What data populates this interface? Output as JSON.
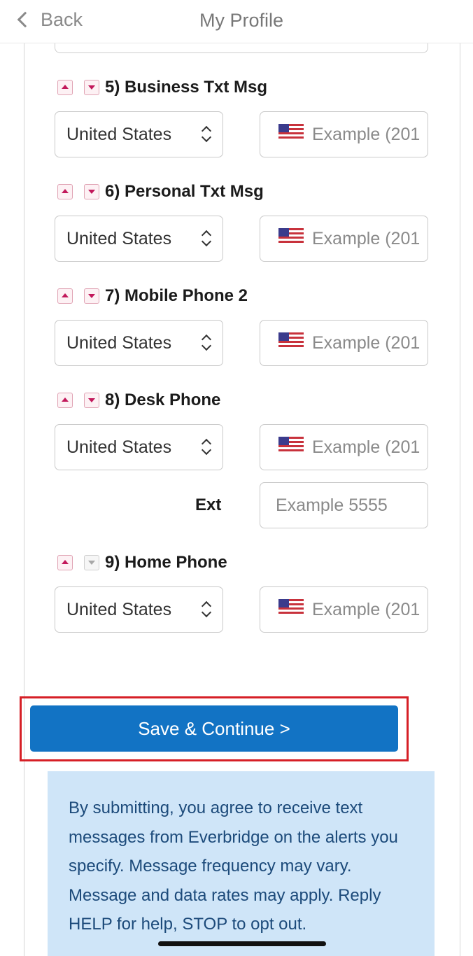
{
  "header": {
    "back_label": "Back",
    "title": "My Profile"
  },
  "phone_fields": [
    {
      "label": "5) Business Txt Msg",
      "country": "United States",
      "placeholder": "Example (201",
      "down_enabled": true
    },
    {
      "label": "6) Personal Txt Msg",
      "country": "United States",
      "placeholder": "Example (201",
      "down_enabled": true
    },
    {
      "label": "7) Mobile Phone 2",
      "country": "United States",
      "placeholder": "Example (201",
      "down_enabled": true
    },
    {
      "label": "8) Desk Phone",
      "country": "United States",
      "placeholder": "Example (201",
      "down_enabled": true
    },
    {
      "label": "9) Home Phone",
      "country": "United States",
      "placeholder": "Example (201",
      "down_enabled": false
    }
  ],
  "ext": {
    "label": "Ext",
    "placeholder": "Example 5555"
  },
  "save_button_label": "Save & Continue >",
  "notice_text": "By submitting, you agree to receive text messages from Everbridge on the alerts you specify. Message frequency may vary. Message and data rates may apply. Reply HELP for help, STOP to opt out.",
  "icons": {
    "back": "chevron-left-icon",
    "move_up": "arrow-up-icon",
    "move_down": "arrow-down-icon",
    "select_caret": "up-down-caret-icon",
    "country_flag": "us-flag-icon"
  },
  "colors": {
    "primary_button": "#1273c4",
    "highlight_outline": "#d61f26",
    "notice_background": "#cfe5f8",
    "arrow_accent": "#c2185b"
  }
}
